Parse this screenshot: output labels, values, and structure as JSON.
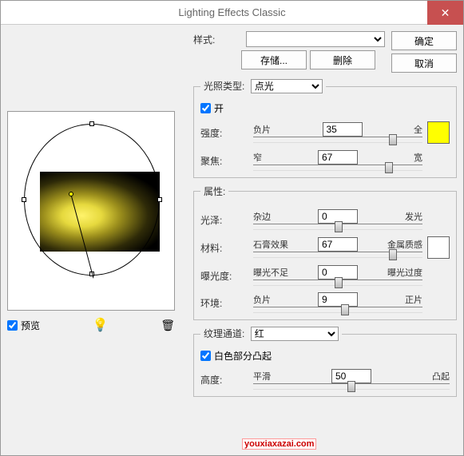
{
  "title": "Lighting Effects Classic",
  "buttons": {
    "ok": "确定",
    "cancel": "取消",
    "save": "存储...",
    "delete": "删除"
  },
  "preview_label": "预览",
  "style": {
    "label": "样式:"
  },
  "light": {
    "legend": "光照类型:",
    "type_selected": "点光",
    "on_label": "开",
    "intensity": {
      "label": "强度:",
      "left": "负片",
      "right": "全",
      "value": "35",
      "pos": 80
    },
    "focus": {
      "label": "聚焦:",
      "left": "窄",
      "right": "宽",
      "value": "67",
      "pos": 78
    }
  },
  "props": {
    "legend": "属性:",
    "gloss": {
      "label": "光泽:",
      "left": "杂边",
      "right": "发光",
      "value": "0",
      "pos": 48
    },
    "material": {
      "label": "材料:",
      "left": "石膏效果",
      "right": "金属质感",
      "value": "67",
      "pos": 80
    },
    "exposure": {
      "label": "曝光度:",
      "left": "曝光不足",
      "right": "曝光过度",
      "value": "0",
      "pos": 48
    },
    "ambient": {
      "label": "环境:",
      "left": "负片",
      "right": "正片",
      "value": "9",
      "pos": 52
    }
  },
  "texture": {
    "legend": "纹理通道:",
    "channel_selected": "红",
    "white_label": "白色部分凸起",
    "height": {
      "label": "高度:",
      "left": "平滑",
      "right": "凸起",
      "value": "50",
      "pos": 48
    }
  },
  "watermark": "youxiaxazai.com"
}
